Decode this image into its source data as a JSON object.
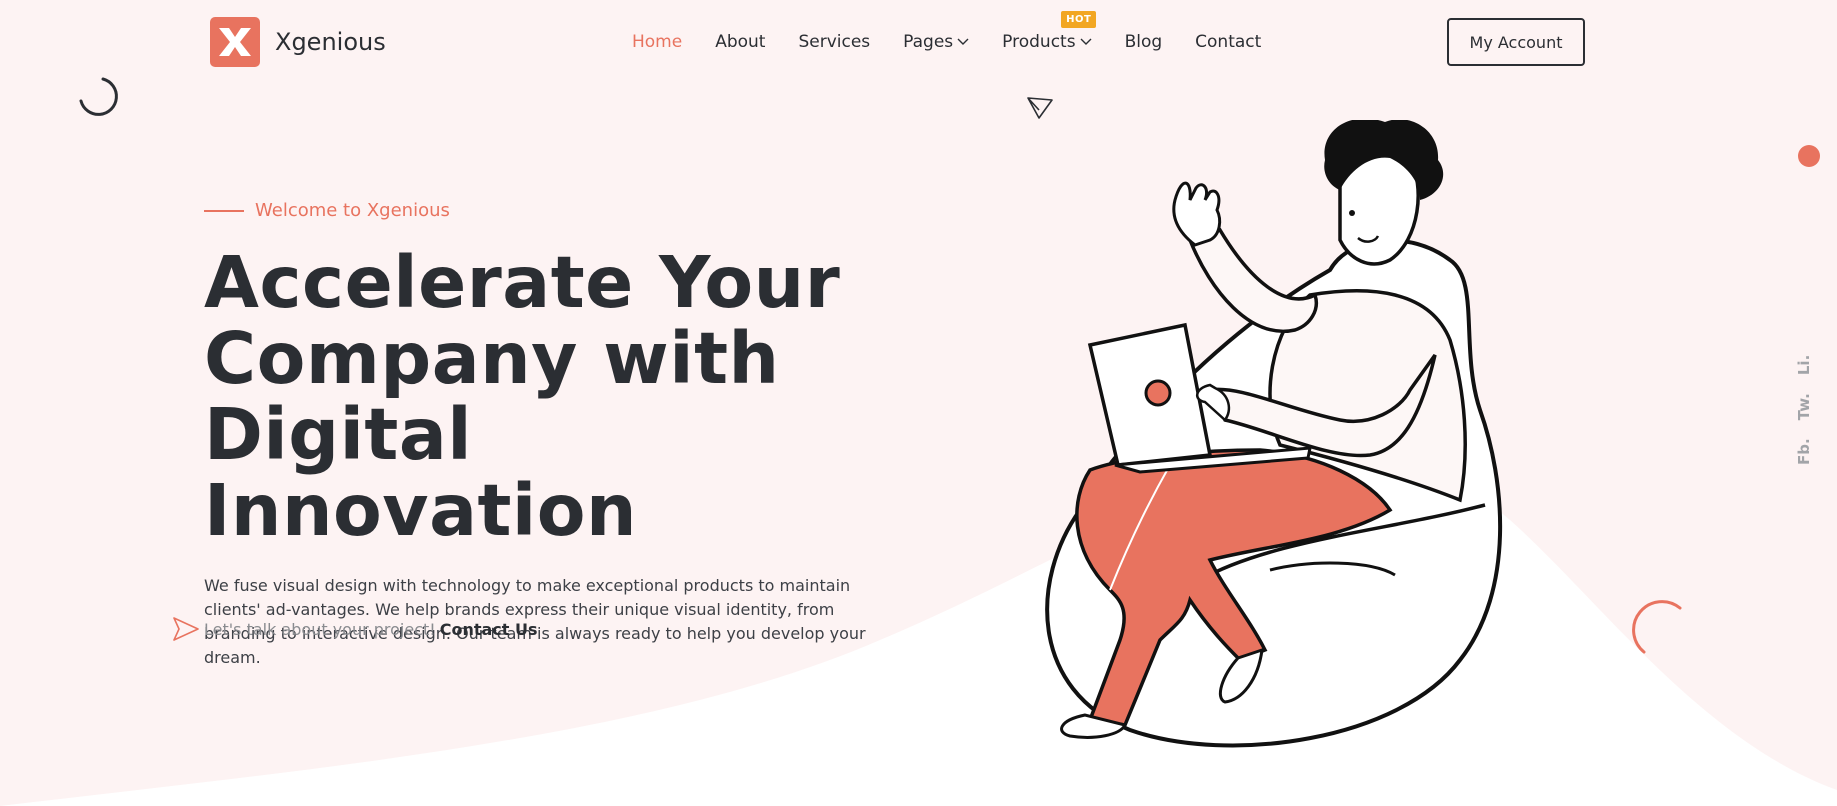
{
  "brand": {
    "name": "Xgenious",
    "accent": "#e8735f"
  },
  "nav": {
    "items": [
      {
        "label": "Home",
        "active": true
      },
      {
        "label": "About"
      },
      {
        "label": "Services"
      },
      {
        "label": "Pages",
        "dropdown": true
      },
      {
        "label": "Products",
        "dropdown": true,
        "badge": "HOT"
      },
      {
        "label": "Blog"
      },
      {
        "label": "Contact"
      }
    ],
    "account_label": "My Account"
  },
  "hero": {
    "welcome": "Welcome to Xgenious",
    "title_lines": [
      "Accelerate Your",
      "Company with",
      "Digital Innovation"
    ],
    "description": "We fuse visual design with technology to make exceptional products to maintain clients' ad-vantages. We help brands express their unique visual identity, from branding to interactive design. Our team is always ready to help you develop your dream.",
    "cta_text": "Let's talk about your project!",
    "cta_link": "Contact Us"
  },
  "social": [
    "Li.",
    "Tw.",
    "Fb."
  ],
  "colors": {
    "background": "#fdf3f3",
    "text": "#2b2e33",
    "badge": "#f2a622"
  }
}
